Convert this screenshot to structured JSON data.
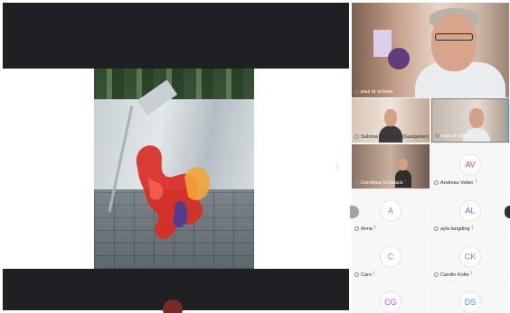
{
  "share": {
    "next_glyph": "›"
  },
  "participants": {
    "main": {
      "name": "paul dr schwer"
    },
    "tiles": [
      {
        "id": "sabrina",
        "name": "Sabrina Angana...",
        "tag": "(Gastgeber)",
        "has_video": true
      },
      {
        "id": "paul-small",
        "name": "paul dr schwer",
        "has_video": true
      },
      {
        "id": "dorothea",
        "name": "Dorothea Schatack",
        "has_video": true,
        "muted": true
      },
      {
        "id": "andreas",
        "name": "Andreas Vetter",
        "initials": "AV",
        "initials_color": "#e4413a",
        "muted": true
      },
      {
        "id": "anna",
        "name": "Anna",
        "initials": "A",
        "initials_color": "#8c8c8c",
        "muted": true
      },
      {
        "id": "ayla",
        "name": "ayla langding",
        "initials": "AL",
        "initials_color": "#7c5cc4",
        "muted": true
      },
      {
        "id": "caro",
        "name": "Caro",
        "initials": "C",
        "initials_color": "#8c8c8c",
        "muted": true
      },
      {
        "id": "carolin",
        "name": "Carolin Kotte",
        "initials": "CK",
        "initials_color": "#8c8c8c",
        "muted": true
      },
      {
        "id": "cg",
        "initials": "CG",
        "initials_color": "#c24fc9"
      },
      {
        "id": "ds",
        "initials": "DS",
        "initials_color": "#2a9fd6"
      }
    ],
    "mute_glyph": "ǃ"
  },
  "colors": {
    "stage_bg": "#1f2023",
    "panel_bg": "#f3f4f6",
    "active_border": "#3a8ee6",
    "mute_red": "#e4413a"
  }
}
